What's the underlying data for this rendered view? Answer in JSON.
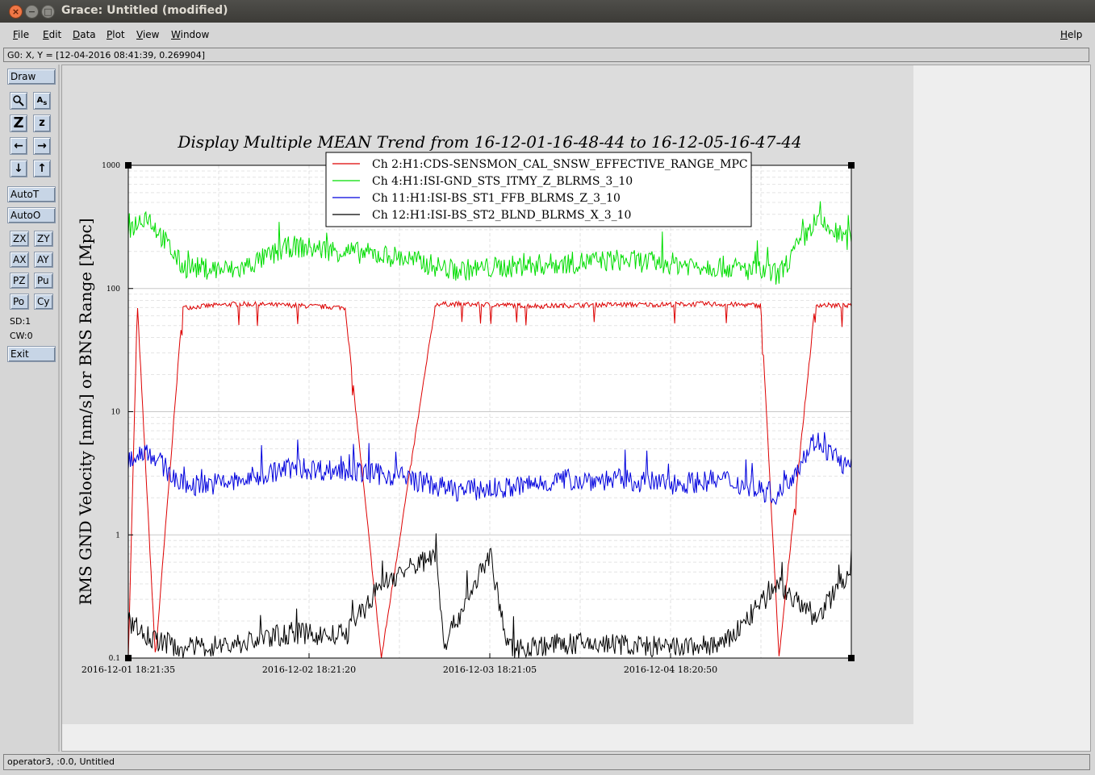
{
  "window": {
    "title": "Grace: Untitled (modified)"
  },
  "menu": {
    "file": "File",
    "edit": "Edit",
    "data": "Data",
    "plot": "Plot",
    "view": "View",
    "window": "Window",
    "help": "Help"
  },
  "locator": "G0: X, Y = [12-04-2016 08:41:39, 0.269904]",
  "toolbar": {
    "draw": "Draw",
    "autot": "AutoT",
    "autoo": "AutoO",
    "zx": "ZX",
    "zy": "ZY",
    "ax": "AX",
    "ay": "AY",
    "pz": "PZ",
    "pu": "Pu",
    "po": "Po",
    "cy": "Cy",
    "sd": "SD:1",
    "cw": "CW:0",
    "exit": "Exit"
  },
  "status": "operator3, :0.0, Untitled",
  "chart_data": {
    "type": "line",
    "title": "Display Multiple MEAN Trend from 16-12-01-16-48-44 to 16-12-05-16-47-44",
    "xlabel": "",
    "ylabel": "RMS GND Velocity [nm/s] or BNS Range [Mpc]",
    "yscale": "log",
    "ylim": [
      0.1,
      1000
    ],
    "y_ticks": [
      "0.1",
      "1",
      "10",
      "100",
      "1000"
    ],
    "x_ticks": [
      "2016-12-01 18:21:35",
      "2016-12-02 18:21:20",
      "2016-12-03 18:21:05",
      "2016-12-04 18:20:50"
    ],
    "x_range_days": [
      0,
      4
    ],
    "grid": true,
    "legend": "top-center",
    "series": [
      {
        "name": "Ch 2:H1:CDS-SENSMON_CAL_SNSW_EFFECTIVE_RANGE_MPC",
        "color": "#dd0000",
        "x": [
          0.0,
          0.05,
          0.15,
          0.3,
          0.6,
          0.9,
          1.2,
          1.4,
          1.7,
          2.0,
          2.3,
          2.6,
          2.9,
          3.2,
          3.5,
          3.6,
          3.8,
          3.98
        ],
        "y": [
          0.1,
          75,
          0.1,
          70,
          75,
          73,
          70,
          0.1,
          75,
          74,
          72,
          74,
          74,
          75,
          73,
          0.1,
          74,
          72
        ]
      },
      {
        "name": "Ch 4:H1:ISI-GND_STS_ITMY_Z_BLRMS_3_10",
        "color": "#00dd00",
        "x": [
          0.0,
          0.1,
          0.3,
          0.6,
          0.9,
          1.2,
          1.5,
          1.8,
          2.1,
          2.4,
          2.7,
          3.0,
          3.3,
          3.6,
          3.8,
          3.98
        ],
        "y": [
          300,
          400,
          150,
          140,
          220,
          200,
          180,
          140,
          150,
          160,
          170,
          160,
          150,
          130,
          350,
          250
        ]
      },
      {
        "name": "Ch 11:H1:ISI-BS_ST1_FFB_BLRMS_Z_3_10",
        "color": "#0000dd",
        "x": [
          0.0,
          0.1,
          0.3,
          0.6,
          0.9,
          1.2,
          1.5,
          1.8,
          2.1,
          2.4,
          2.7,
          3.0,
          3.3,
          3.6,
          3.8,
          3.98
        ],
        "y": [
          4,
          5,
          2.5,
          2.7,
          3.5,
          3.3,
          3,
          2.3,
          2.4,
          2.8,
          2.8,
          2.6,
          2.8,
          2.1,
          6,
          3.5
        ]
      },
      {
        "name": "Ch 12:H1:ISI-BS_ST2_BLND_BLRMS_X_3_10",
        "color": "#000000",
        "x": [
          0.0,
          0.1,
          0.3,
          0.6,
          0.9,
          1.2,
          1.4,
          1.7,
          1.75,
          2.0,
          2.1,
          2.4,
          2.7,
          3.0,
          3.3,
          3.6,
          3.8,
          3.98
        ],
        "y": [
          0.2,
          0.15,
          0.12,
          0.13,
          0.16,
          0.15,
          0.4,
          0.7,
          0.13,
          0.7,
          0.12,
          0.13,
          0.13,
          0.12,
          0.13,
          0.4,
          0.2,
          0.5
        ]
      }
    ]
  }
}
